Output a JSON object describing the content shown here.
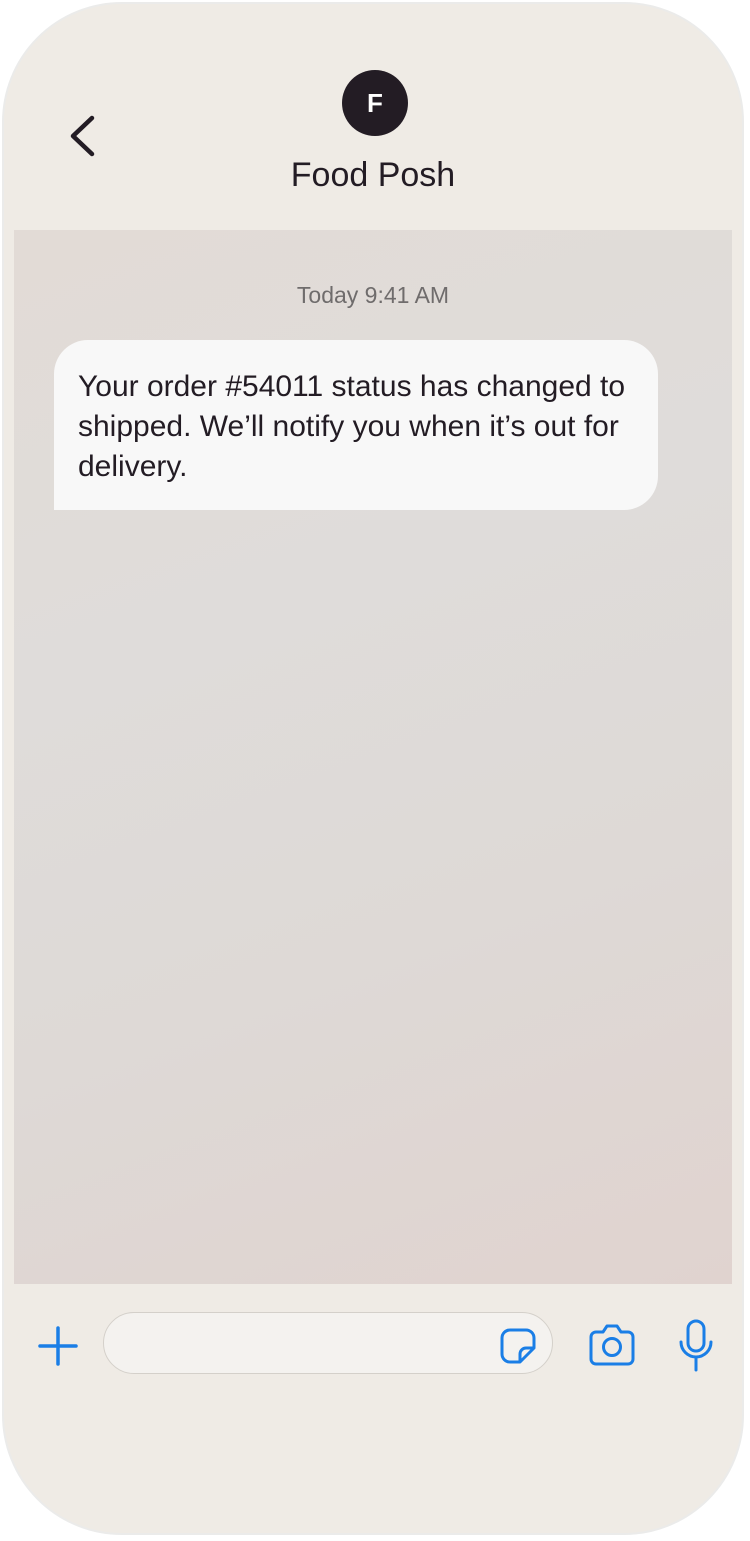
{
  "header": {
    "avatar_letter": "F",
    "contact_name": "Food Posh"
  },
  "chat": {
    "timestamp": "Today 9:41 AM",
    "messages": [
      {
        "text": "Your order #54011 status has changed to shipped. We’ll notify you when it’s out for delivery."
      }
    ]
  },
  "input": {
    "value": "",
    "placeholder": ""
  },
  "icons": {
    "back": "chevron-left-icon",
    "plus": "plus-icon",
    "sticker": "sticker-icon",
    "camera": "camera-icon",
    "mic": "microphone-icon"
  },
  "colors": {
    "accent": "#1a7ee6",
    "text": "#231c24",
    "timestamp": "#6f6c6c",
    "bubble": "#f8f8f8",
    "chrome": "#efebe5"
  }
}
